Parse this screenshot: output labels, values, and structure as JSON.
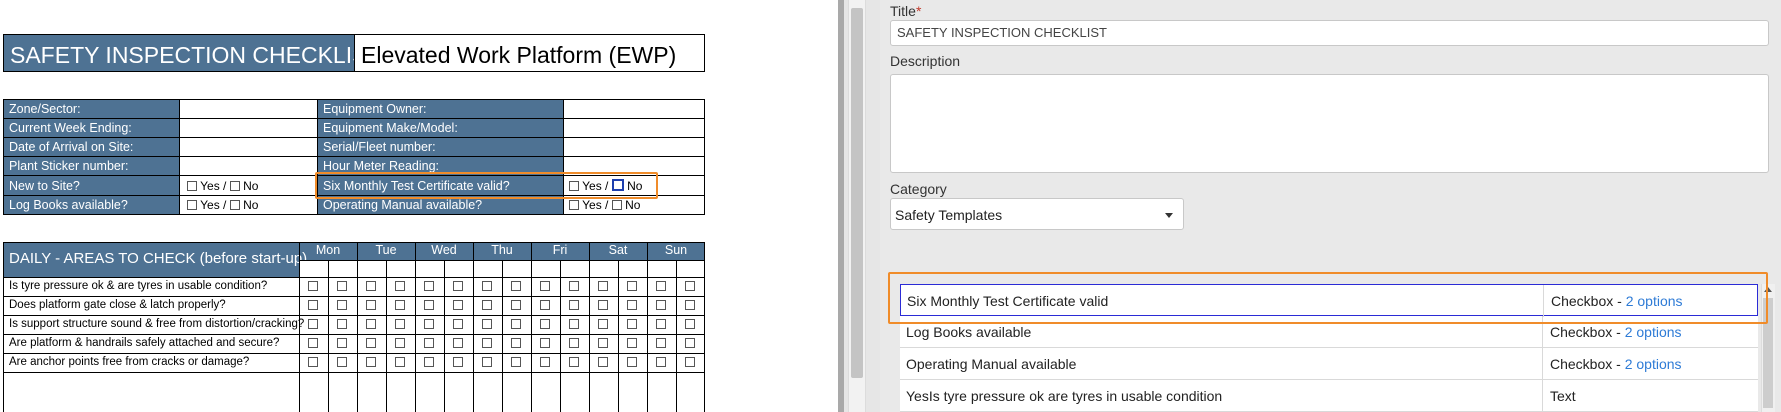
{
  "doc": {
    "title_left": "SAFETY INSPECTION CHECKLIST",
    "title_right": "Elevated Work Platform (EWP)",
    "info_rows": [
      {
        "left_label": "Zone/Sector:",
        "left_value": "",
        "right_label": "Equipment Owner:",
        "right_value": ""
      },
      {
        "left_label": "Current Week Ending:",
        "left_value": "",
        "right_label": "Equipment Make/Model:",
        "right_value": ""
      },
      {
        "left_label": "Date of Arrival on Site:",
        "left_value": "",
        "right_label": "Serial/Fleet number:",
        "right_value": ""
      },
      {
        "left_label": "Plant Sticker number:",
        "left_value": "",
        "right_label": "Hour Meter Reading:",
        "right_value": ""
      },
      {
        "left_label": "New to Site?",
        "left_value": "Yes / No",
        "right_label": "Six Monthly Test Certificate valid?",
        "right_value": "Yes / No"
      },
      {
        "left_label": "Log Books available?",
        "left_value": "Yes / No",
        "right_label": "Operating Manual available?",
        "right_value": "Yes / No"
      }
    ],
    "yes_no_sep": "Yes /",
    "no_word": "No",
    "daily_title": "DAILY - AREAS TO CHECK (before start-up)",
    "days": [
      "Mon",
      "Tue",
      "Wed",
      "Thu",
      "Fri",
      "Sat",
      "Sun"
    ],
    "yes": "Yes",
    "no": "No",
    "checks": [
      "Is tyre pressure ok & are tyres in usable condition?",
      "Does platform gate close & latch properly?",
      "Is support structure sound & free from distortion/cracking?",
      "Are platform & handrails safely attached and secure?",
      "Are anchor points free from cracks or damage?"
    ]
  },
  "form": {
    "title_label": "Title",
    "required_mark": "*",
    "title_value": "SAFETY INSPECTION CHECKLIST",
    "description_label": "Description",
    "description_value": "",
    "category_label": "Category",
    "category_value": "Safety Templates",
    "fields": [
      {
        "name": "Six Monthly Test Certificate valid",
        "type": "Checkbox - ",
        "options": "2 options"
      },
      {
        "name": "Log Books available",
        "type": "Checkbox - ",
        "options": "2 options"
      },
      {
        "name": "Operating Manual available",
        "type": "Checkbox - ",
        "options": "2 options"
      },
      {
        "name": "YesIs tyre pressure ok are tyres in usable condition",
        "type": "Text",
        "options": ""
      }
    ]
  },
  "colors": {
    "header_blue": "#4e7293",
    "highlight_orange": "#f08c2a",
    "link_blue": "#2e7bd6"
  }
}
